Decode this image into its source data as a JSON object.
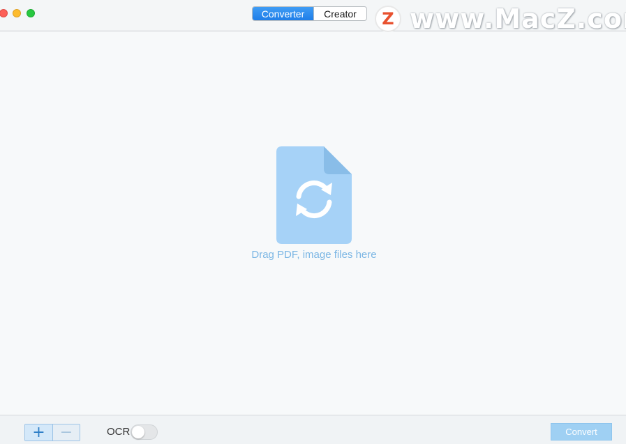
{
  "titlebar": {
    "tabs": [
      {
        "label": "Converter",
        "active": true
      },
      {
        "label": "Creator",
        "active": false
      }
    ]
  },
  "watermark": {
    "logo_letter": "Z",
    "text": "www.MacZ.com"
  },
  "drop_zone": {
    "text": "Drag PDF, image files here",
    "icon": "document-convert-icon"
  },
  "bottombar": {
    "add_label": "+",
    "remove_label": "−",
    "ocr_label": "OCR",
    "ocr_enabled": false,
    "convert_label": "Convert"
  },
  "colors": {
    "accent": "#1f7ee8",
    "drop_text": "#7bb6e4",
    "doc_icon": "#a6d2f7",
    "convert_button": "#9fd0f3"
  }
}
